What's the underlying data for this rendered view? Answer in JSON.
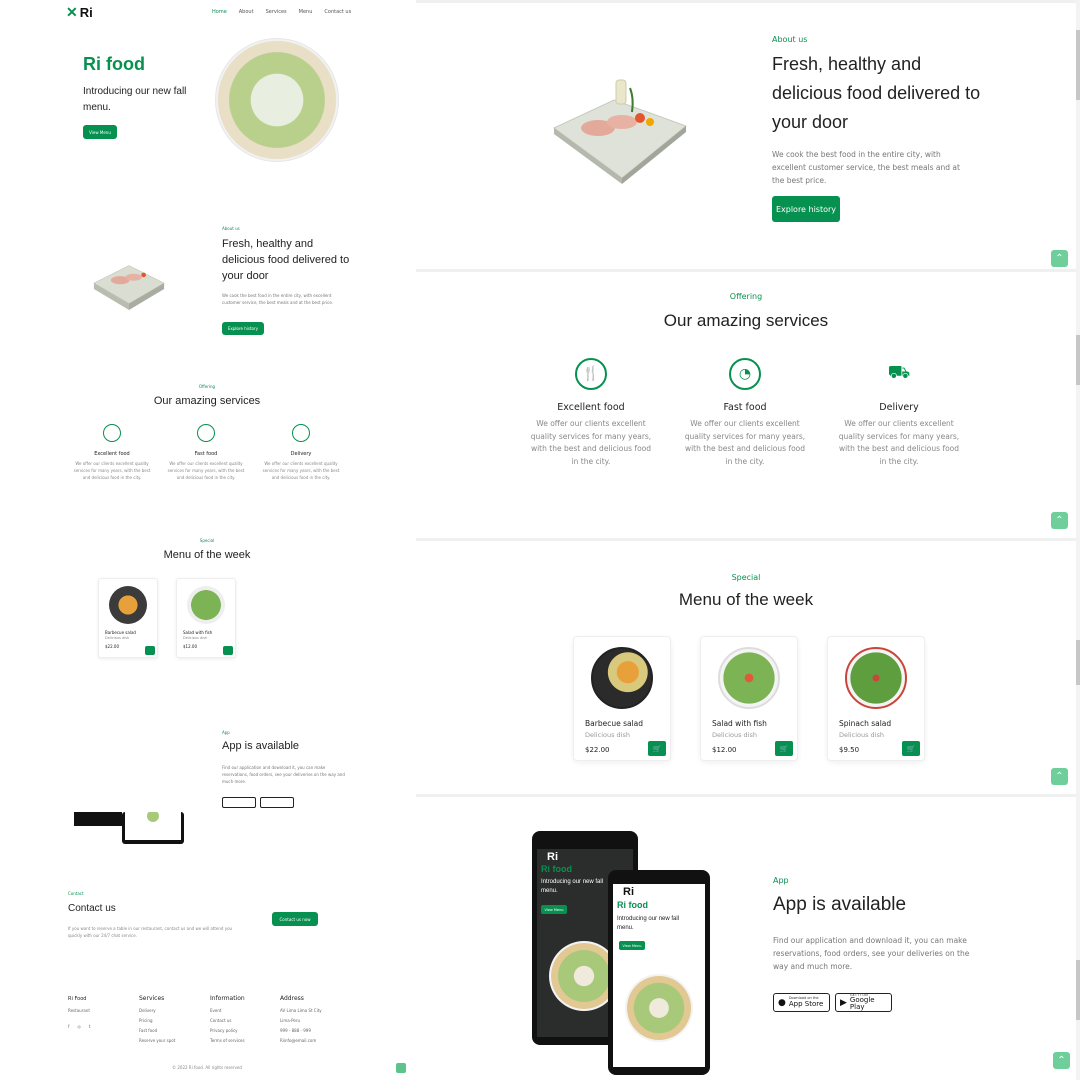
{
  "colors": {
    "accent": "#079150",
    "scroll_top_button": "#6fcf9a"
  },
  "nav": {
    "logo": "Ri",
    "links": [
      "Home",
      "About",
      "Services",
      "Menu",
      "Contact us"
    ]
  },
  "hero": {
    "title": "Ri food",
    "subtitle": "Introducing our new fall menu.",
    "button": "View Menu"
  },
  "about": {
    "label": "About us",
    "title": "Fresh, healthy and delicious food delivered to your door",
    "text": "We cook the best food in the entire city, with excellent customer service, the best meals and at the best price.",
    "button": "Explore history"
  },
  "services": {
    "label": "Offering",
    "title": "Our amazing services",
    "items": [
      {
        "icon": "dish-icon",
        "title": "Excellent food",
        "text": "We offer our clients excellent quality services for many years, with the best and delicious food in the city."
      },
      {
        "icon": "pizza-icon",
        "title": "Fast food",
        "text": "We offer our clients excellent quality services for many years, with the best and delicious food in the city."
      },
      {
        "icon": "delivery-truck-icon",
        "title": "Delivery",
        "text": "We offer our clients excellent quality services for many years, with the best and delicious food in the city."
      }
    ]
  },
  "menu": {
    "label": "Special",
    "title": "Menu of the week",
    "items": [
      {
        "name": "Barbecue salad",
        "subtitle": "Delicious dish",
        "price": "$22.00",
        "color": "#e8a13a"
      },
      {
        "name": "Salad with fish",
        "subtitle": "Delicious dish",
        "price": "$12.00",
        "color": "#7cb354"
      },
      {
        "name": "Spinach salad",
        "subtitle": "Delicious dish",
        "price": "$9.50",
        "color": "#5f9e3f"
      }
    ]
  },
  "app": {
    "label": "App",
    "title": "App is available",
    "text": "Find our application and download it, you can make reservations, food orders, see your deliveries on the way and much more.",
    "badges": [
      {
        "small": "Download on the",
        "big": "App Store",
        "icon": "apple-icon"
      },
      {
        "small": "GET IT ON",
        "big": "Google Play",
        "icon": "play-icon"
      }
    ],
    "phone_screen": {
      "logo": "Ri",
      "title": "Ri food",
      "subtitle": "Introducing our new fall menu.",
      "button": "View Menu"
    }
  },
  "contact": {
    "label": "Contact",
    "title": "Contact us",
    "text": "If you want to reserve a table in our restaurant, contact us and we will attend you quickly with our 24/7 chat service.",
    "button": "Contact us now"
  },
  "footer": {
    "brand": "Ri Food",
    "brand_sub": "Restaurant",
    "columns": [
      {
        "title": "Services",
        "items": [
          "Delivery",
          "Pricing",
          "Fast food",
          "Reserve your spot"
        ]
      },
      {
        "title": "Information",
        "items": [
          "Event",
          "Contact us",
          "Privacy policy",
          "Terms of services"
        ]
      },
      {
        "title": "Address",
        "items": [
          "AV Lima Lima St City",
          "Lima-Peru",
          "999 - 888 - 999",
          "Riinfo@email.com"
        ]
      }
    ],
    "copyright": "© 2022 Ri food. All rights reserved"
  }
}
